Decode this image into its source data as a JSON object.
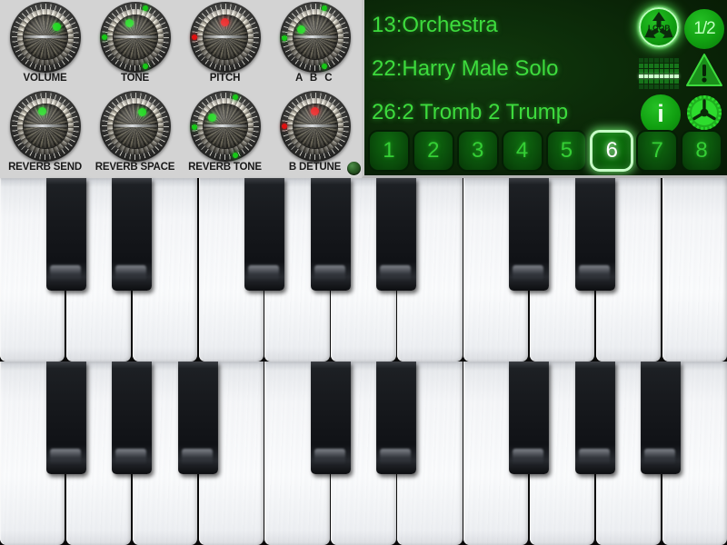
{
  "knobs": [
    {
      "label": "VOLUME",
      "indicator_color": "green",
      "indicator_angle": 48,
      "leds": []
    },
    {
      "label": "TONE",
      "indicator_color": "green",
      "indicator_angle": 340,
      "leds": [
        {
          "color": "green",
          "angle": 270
        },
        {
          "color": "green",
          "angle": 160
        },
        {
          "color": "green",
          "angle": 20
        }
      ]
    },
    {
      "label": "PITCH",
      "indicator_color": "red",
      "indicator_angle": 0,
      "leds": [
        {
          "color": "red",
          "angle": 270
        }
      ]
    },
    {
      "label": "A  B  C",
      "indicator_color": "green",
      "indicator_angle": 300,
      "wide": true,
      "leds": [
        {
          "color": "green",
          "angle": 268
        },
        {
          "color": "green",
          "angle": 162
        },
        {
          "color": "green",
          "angle": 18
        }
      ]
    },
    {
      "label": "REVERB SEND",
      "indicator_color": "green",
      "indicator_angle": 350,
      "leds": []
    },
    {
      "label": "REVERB SPACE",
      "indicator_color": "green",
      "indicator_angle": 28,
      "leds": []
    },
    {
      "label": "REVERB TONE",
      "indicator_color": "green",
      "indicator_angle": 302,
      "leds": [
        {
          "color": "green",
          "angle": 268
        },
        {
          "color": "green",
          "angle": 160
        },
        {
          "color": "green",
          "angle": 20
        }
      ]
    },
    {
      "label": "B DETUNE",
      "indicator_color": "red",
      "indicator_angle": 0,
      "leds": [
        {
          "color": "red",
          "angle": 270
        }
      ]
    }
  ],
  "corner_led": {
    "name": "status-led",
    "color": "#2b5c26"
  },
  "display": {
    "background_color": "#0a2a08",
    "text_color": "#3ddb3d",
    "lines": [
      "13:Orchestra",
      "22:Harry Male Solo",
      "26:2 Tromb 2 Trump"
    ],
    "icons": [
      {
        "name": "loop-icon",
        "label": "LOOP",
        "active": true
      },
      {
        "name": "half-speed-icon",
        "label": "1/2",
        "active": false
      },
      {
        "name": "level-meter-icon",
        "label": "",
        "active": false
      },
      {
        "name": "warning-icon",
        "label": "!",
        "active": false
      },
      {
        "name": "info-icon",
        "label": "i",
        "active": false
      },
      {
        "name": "settings-gear-icon",
        "label": "",
        "active": false
      }
    ],
    "presets": [
      {
        "label": "1",
        "selected": false
      },
      {
        "label": "2",
        "selected": false
      },
      {
        "label": "3",
        "selected": false
      },
      {
        "label": "4",
        "selected": false
      },
      {
        "label": "5",
        "selected": false
      },
      {
        "label": "6",
        "selected": true
      },
      {
        "label": "7",
        "selected": false
      },
      {
        "label": "8",
        "selected": false
      }
    ]
  },
  "keyboard": {
    "rows": [
      {
        "name": "upper-octave-row",
        "white_key_count": 11,
        "black_key_positions": [
          1,
          2,
          4,
          5,
          6,
          8,
          9
        ]
      },
      {
        "name": "lower-octave-row",
        "white_key_count": 11,
        "black_key_positions": [
          1,
          2,
          3,
          5,
          6,
          8,
          9,
          10
        ]
      }
    ]
  }
}
